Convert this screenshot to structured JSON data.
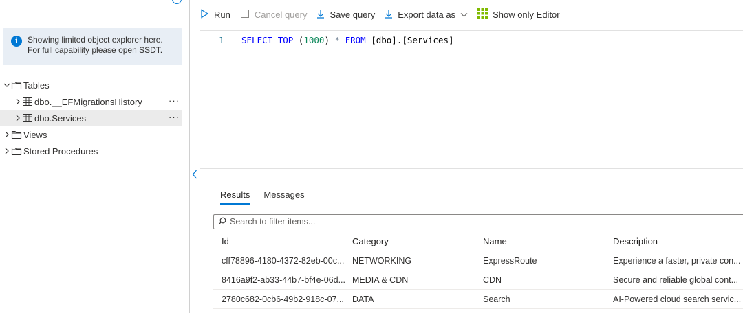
{
  "explorer": {
    "info_message": "Showing limited object explorer here. For full capability please open SSDT.",
    "tree": {
      "tables_label": "Tables",
      "tables": [
        {
          "label": "dbo.__EFMigrationsHistory",
          "more": "···"
        },
        {
          "label": "dbo.Services",
          "more": "···"
        }
      ],
      "views_label": "Views",
      "stored_procedures_label": "Stored Procedures"
    }
  },
  "toolbar": {
    "run_label": "Run",
    "cancel_label": "Cancel query",
    "save_label": "Save query",
    "export_label": "Export data as",
    "show_editor_label": "Show only Editor"
  },
  "editor": {
    "line_number": "1",
    "code": {
      "kw_select": "SELECT",
      "kw_top": "TOP",
      "paren_open": "(",
      "num_1000": "1000",
      "paren_close": ")",
      "star": "*",
      "kw_from": "FROM",
      "table_ref": "[dbo].[Services]"
    }
  },
  "results": {
    "tabs": [
      {
        "label": "Results",
        "active": true
      },
      {
        "label": "Messages",
        "active": false
      }
    ],
    "filter_placeholder": "Search to filter items...",
    "columns": [
      "Id",
      "Category",
      "Name",
      "Description"
    ],
    "rows": [
      [
        "cff78896-4180-4372-82eb-00c...",
        "NETWORKING",
        "ExpressRoute",
        "Experience a faster, private con..."
      ],
      [
        "8416a9f2-ab33-44b7-bf4e-06d...",
        "MEDIA & CDN",
        "CDN",
        "Secure and reliable global cont..."
      ],
      [
        "2780c682-0cb6-49b2-918c-07...",
        "DATA",
        "Search",
        "AI-Powered cloud search servic..."
      ]
    ]
  },
  "colors": {
    "accent": "#0078d4",
    "grid_icon_green": "#7fba00"
  }
}
